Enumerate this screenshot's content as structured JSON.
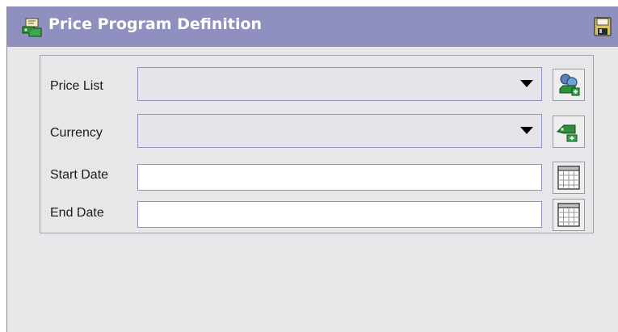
{
  "window": {
    "title": "Price Program Definition",
    "title_icon": "price-program-icon",
    "save_icon": "floppy-disk-save-icon"
  },
  "form": {
    "price_list": {
      "label": "Price List",
      "value": "",
      "lookup_icon": "price-list-lookup-icon"
    },
    "currency": {
      "label": "Currency",
      "value": "",
      "lookup_icon": "currency-lookup-icon"
    },
    "start_date": {
      "label": "Start Date",
      "value": "",
      "calendar_icon": "calendar-icon"
    },
    "end_date": {
      "label": "End Date",
      "value": "",
      "calendar_icon": "calendar-icon"
    }
  },
  "colors": {
    "titlebar": "#8f8fc0",
    "window_bg": "#e9e6ea",
    "field_border": "#8d93c2",
    "title_text": "#ffffff"
  }
}
